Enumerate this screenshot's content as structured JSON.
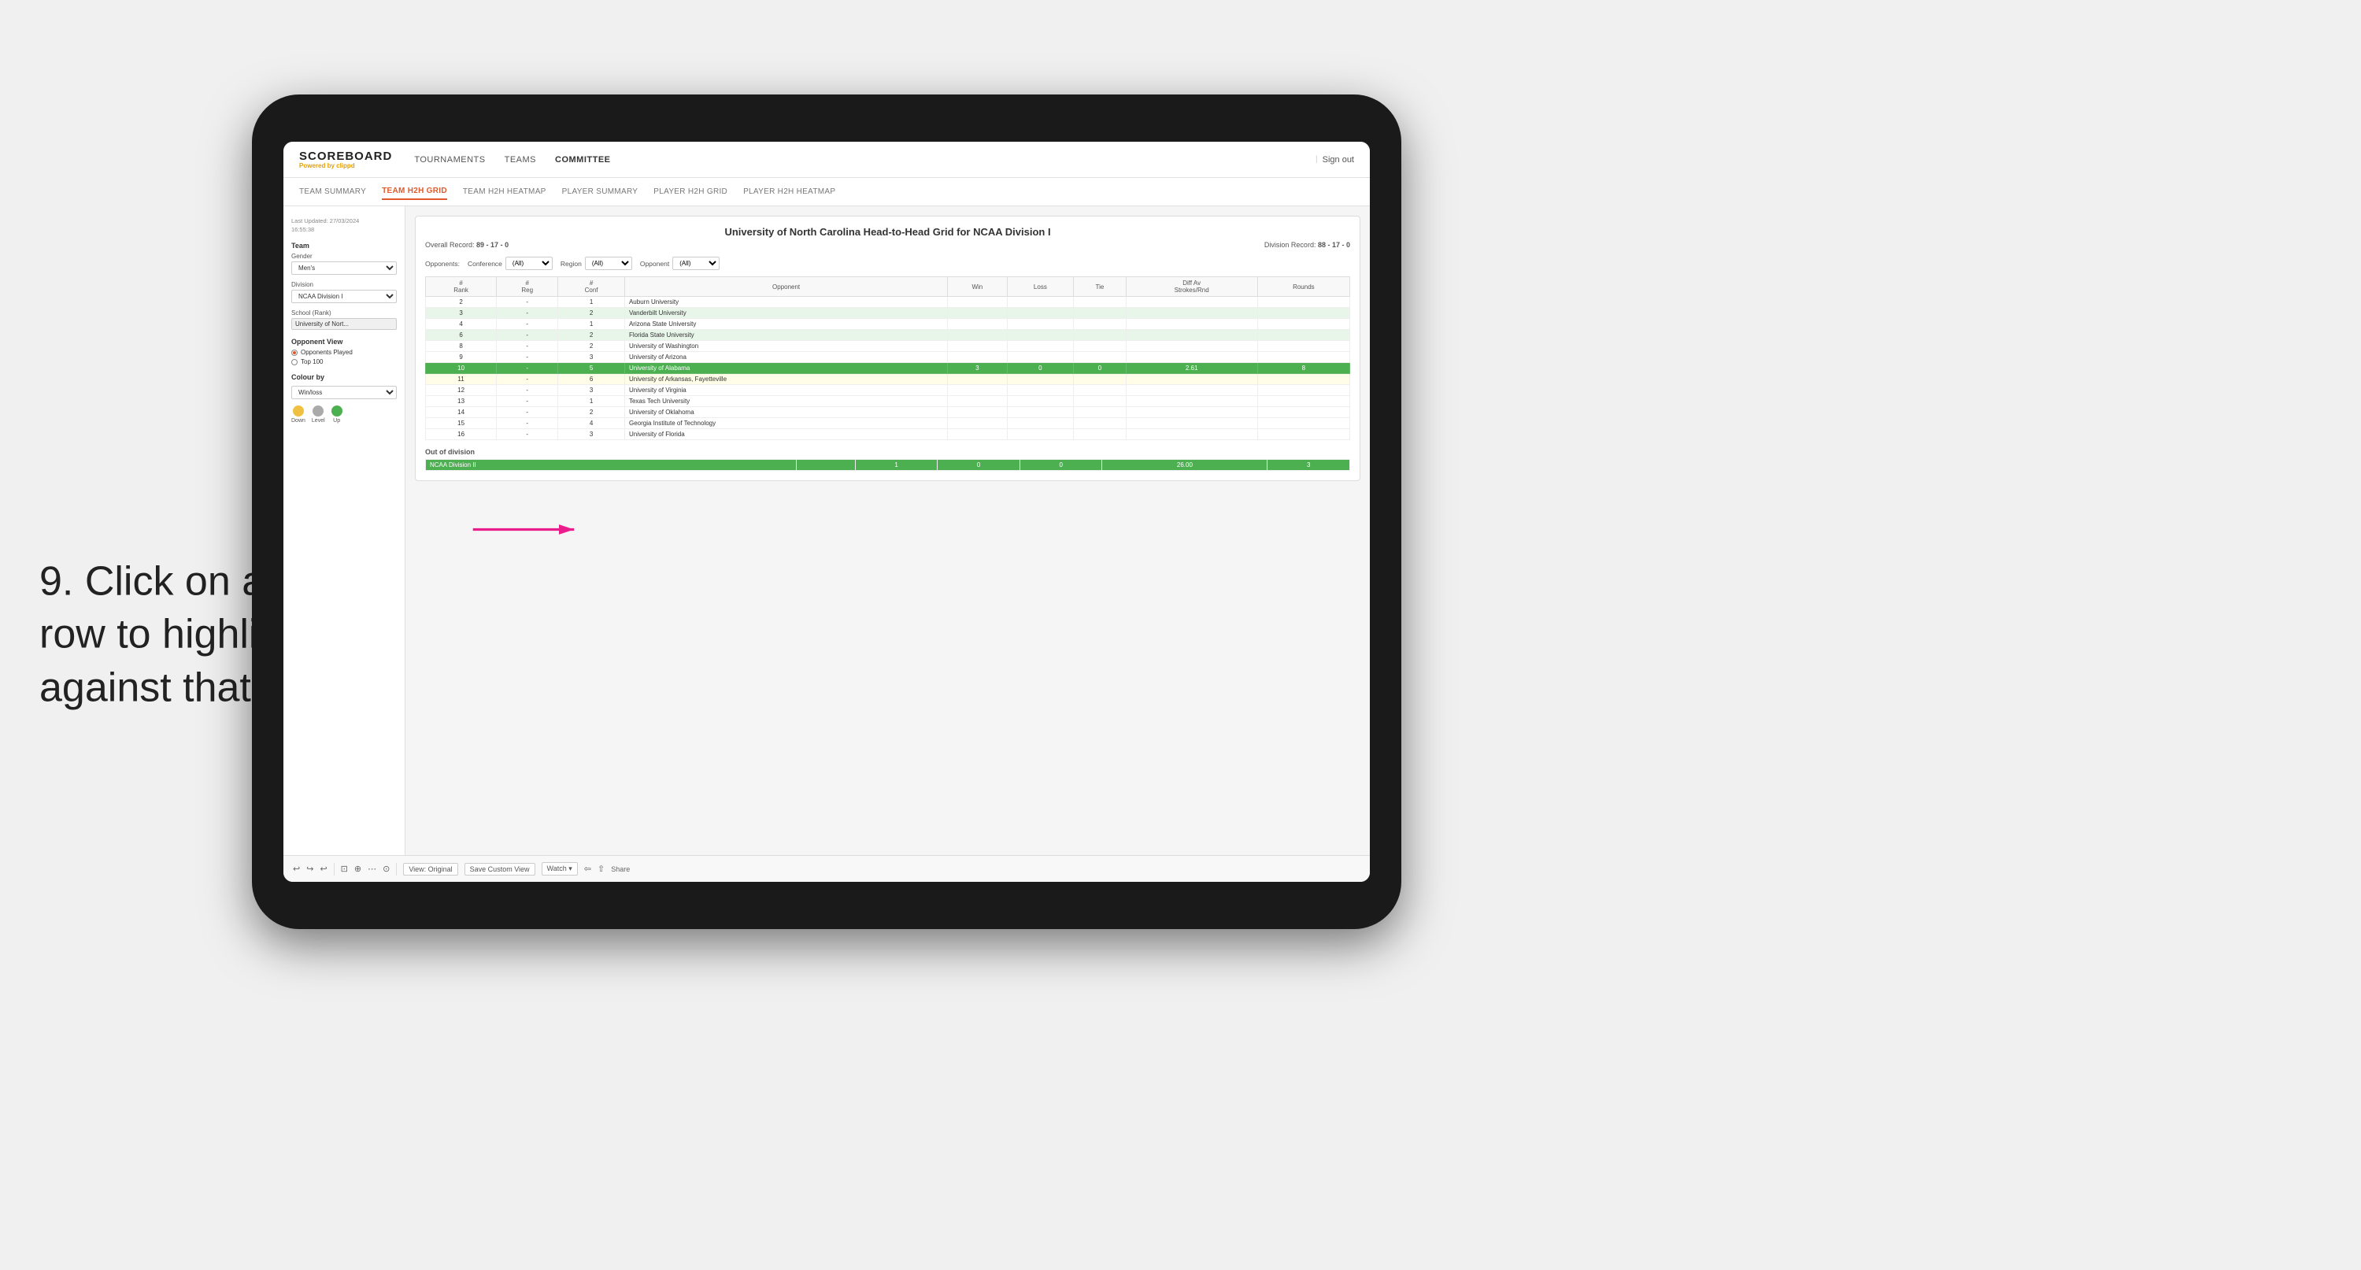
{
  "instruction": {
    "step": "9.",
    "text": "Click on a team's row to highlight results against that opponent"
  },
  "brand": {
    "title": "SCOREBOARD",
    "sub_prefix": "Powered by ",
    "sub_brand": "clippd"
  },
  "nav": {
    "items": [
      "TOURNAMENTS",
      "TEAMS",
      "COMMITTEE"
    ],
    "sign_out": "Sign out"
  },
  "sub_nav": {
    "items": [
      "TEAM SUMMARY",
      "TEAM H2H GRID",
      "TEAM H2H HEATMAP",
      "PLAYER SUMMARY",
      "PLAYER H2H GRID",
      "PLAYER H2H HEATMAP"
    ],
    "active": "TEAM H2H GRID"
  },
  "sidebar": {
    "timestamp_label": "Last Updated: 27/03/2024",
    "timestamp_time": "16:55:38",
    "team_label": "Team",
    "gender_label": "Gender",
    "gender_value": "Men's",
    "division_label": "Division",
    "division_value": "NCAA Division I",
    "school_label": "School (Rank)",
    "school_value": "University of Nort...",
    "opponent_view_label": "Opponent View",
    "radio_opponents": "Opponents Played",
    "radio_top100": "Top 100",
    "colour_by_label": "Colour by",
    "colour_by_value": "Win/loss",
    "legend": [
      {
        "label": "Down",
        "color": "#f0c040"
      },
      {
        "label": "Level",
        "color": "#aaaaaa"
      },
      {
        "label": "Up",
        "color": "#4caf50"
      }
    ]
  },
  "grid": {
    "title": "University of North Carolina Head-to-Head Grid for NCAA Division I",
    "overall_record_label": "Overall Record:",
    "overall_record_value": "89 - 17 - 0",
    "division_record_label": "Division Record:",
    "division_record_value": "88 - 17 - 0",
    "filters": {
      "opponents_label": "Opponents:",
      "conference_label": "Conference",
      "conference_value": "(All)",
      "region_label": "Region",
      "region_value": "(All)",
      "opponent_label": "Opponent",
      "opponent_value": "(All)"
    },
    "columns": [
      "#\nRank",
      "#\nReg",
      "#\nConf",
      "Opponent",
      "Win",
      "Loss",
      "Tie",
      "Diff Av\nStrokes/Rnd",
      "Rounds"
    ],
    "rows": [
      {
        "rank": "2",
        "reg": "-",
        "conf": "1",
        "opponent": "Auburn University",
        "win": "",
        "loss": "",
        "tie": "",
        "diff": "",
        "rounds": "",
        "style": "normal"
      },
      {
        "rank": "3",
        "reg": "-",
        "conf": "2",
        "opponent": "Vanderbilt University",
        "win": "",
        "loss": "",
        "tie": "",
        "diff": "",
        "rounds": "",
        "style": "light-green"
      },
      {
        "rank": "4",
        "reg": "-",
        "conf": "1",
        "opponent": "Arizona State University",
        "win": "",
        "loss": "",
        "tie": "",
        "diff": "",
        "rounds": "",
        "style": "normal"
      },
      {
        "rank": "6",
        "reg": "-",
        "conf": "2",
        "opponent": "Florida State University",
        "win": "",
        "loss": "",
        "tie": "",
        "diff": "",
        "rounds": "",
        "style": "light-green"
      },
      {
        "rank": "8",
        "reg": "-",
        "conf": "2",
        "opponent": "University of Washington",
        "win": "",
        "loss": "",
        "tie": "",
        "diff": "",
        "rounds": "",
        "style": "normal"
      },
      {
        "rank": "9",
        "reg": "-",
        "conf": "3",
        "opponent": "University of Arizona",
        "win": "",
        "loss": "",
        "tie": "",
        "diff": "",
        "rounds": "",
        "style": "normal"
      },
      {
        "rank": "10",
        "reg": "-",
        "conf": "5",
        "opponent": "University of Alabama",
        "win": "3",
        "loss": "0",
        "tie": "0",
        "diff": "2.61",
        "rounds": "8",
        "style": "highlighted"
      },
      {
        "rank": "11",
        "reg": "-",
        "conf": "6",
        "opponent": "University of Arkansas, Fayetteville",
        "win": "",
        "loss": "",
        "tie": "",
        "diff": "",
        "rounds": "",
        "style": "light-yellow"
      },
      {
        "rank": "12",
        "reg": "-",
        "conf": "3",
        "opponent": "University of Virginia",
        "win": "",
        "loss": "",
        "tie": "",
        "diff": "",
        "rounds": "",
        "style": "normal"
      },
      {
        "rank": "13",
        "reg": "-",
        "conf": "1",
        "opponent": "Texas Tech University",
        "win": "",
        "loss": "",
        "tie": "",
        "diff": "",
        "rounds": "",
        "style": "normal"
      },
      {
        "rank": "14",
        "reg": "-",
        "conf": "2",
        "opponent": "University of Oklahoma",
        "win": "",
        "loss": "",
        "tie": "",
        "diff": "",
        "rounds": "",
        "style": "normal"
      },
      {
        "rank": "15",
        "reg": "-",
        "conf": "4",
        "opponent": "Georgia Institute of Technology",
        "win": "",
        "loss": "",
        "tie": "",
        "diff": "",
        "rounds": "",
        "style": "normal"
      },
      {
        "rank": "16",
        "reg": "-",
        "conf": "3",
        "opponent": "University of Florida",
        "win": "",
        "loss": "",
        "tie": "",
        "diff": "",
        "rounds": "",
        "style": "normal"
      }
    ],
    "out_of_division_label": "Out of division",
    "out_of_division_row": {
      "division": "NCAA Division II",
      "win": "1",
      "loss": "0",
      "tie": "0",
      "diff": "26.00",
      "rounds": "3",
      "style": "highlighted"
    }
  },
  "toolbar": {
    "buttons": [
      "View: Original",
      "Save Custom View",
      "Watch ▾"
    ],
    "icons": [
      "↩",
      "↪",
      "↩",
      "⊡",
      "+",
      "·",
      "⊙"
    ]
  }
}
